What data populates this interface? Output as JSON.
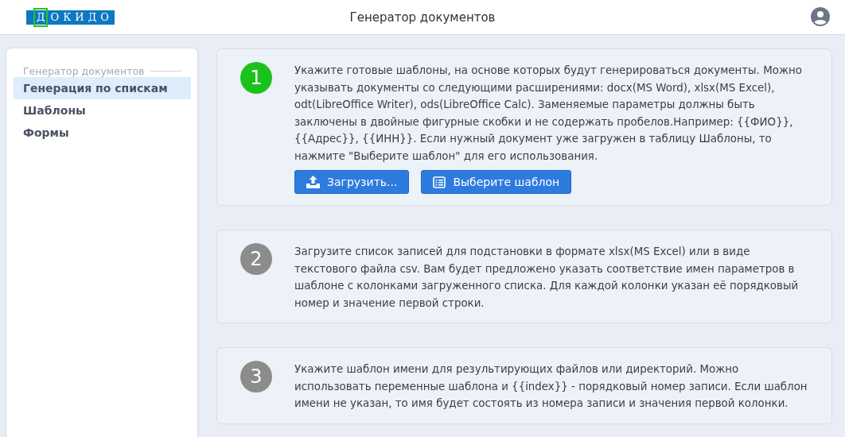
{
  "header": {
    "logo": {
      "highlight": "Д",
      "rest": "ОКИДО"
    },
    "title": "Генератор документов"
  },
  "sidebar": {
    "section": "Генератор документов",
    "items": [
      {
        "label": "Генерация по спискам",
        "selected": true
      },
      {
        "label": "Шаблоны",
        "selected": false
      },
      {
        "label": "Формы",
        "selected": false
      }
    ]
  },
  "steps": [
    {
      "number": "1",
      "active": true,
      "text": "Укажите готовые шаблоны, на основе которых будут генерироваться документы. Можно указывать документы со следующими расширениями: docx(MS Word), xlsx(MS Excel), odt(LibreOffice Writer), ods(LibreOffice Calc). Заменяемые параметры должны быть заключены в двойные фигурные скобки и не содержать пробелов.Например: {{ФИО}}, {{Адрес}}, {{ИНН}}. Если нужный документ уже загружен в таблицу Шаблоны, то нажмите \"Выберите шаблон\" для его использования.",
      "buttons": [
        {
          "kind": "upload",
          "label": "Загрузить..."
        },
        {
          "kind": "list",
          "label": "Выберите шаблон"
        }
      ]
    },
    {
      "number": "2",
      "active": false,
      "text": "Загрузите список записей для подстановки в формате xlsx(MS Excel) или в виде текстового файла csv. Вам будет предложено указать соответствие имен параметров в шаблоне с колонками загруженного списка. Для каждой колонки указан её порядковый номер и значение первой строки."
    },
    {
      "number": "3",
      "active": false,
      "text": "Укажите шаблон имени для результирующих файлов или директорий. Можно использовать переменные шаблона и {{index}} - порядковый номер записи. Если шаблон имени не указан, то имя будет состоять из номера записи и значения первой колонки."
    }
  ]
}
